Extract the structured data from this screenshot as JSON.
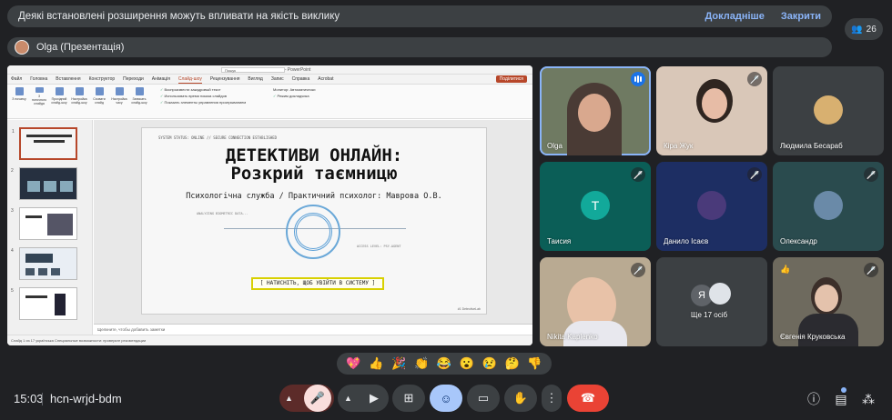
{
  "banner": {
    "message": "Деякі встановлені розширення можуть впливати на якість виклику",
    "details_link": "Докладніше",
    "close_link": "Закрити"
  },
  "participants_count": "26",
  "presenter": {
    "label": "Olga (Презентація)"
  },
  "presentation": {
    "window_title": "CYBER_DETECTIVE_03 — PowerPoint",
    "search_placeholder": "Пошук",
    "menu": [
      "Файл",
      "Головна",
      "Вставлення",
      "Конструктор",
      "Переходи",
      "Анімація",
      "Слайд-шоу",
      "Рецензування",
      "Вигляд",
      "Запис",
      "Справка",
      "Acrobat"
    ],
    "active_menu": "Слайд-шоу",
    "share_label": "Поділитися",
    "ribbon_buttons": [
      "З початку",
      "З поточного слайда",
      "Прохідний слайд-шоу",
      "Настройка слайд-шоу",
      "Сховати слайд",
      "Настройка часу",
      "Записать слайд-шоу"
    ],
    "ribbon_options": [
      "Воспроизвести закадровый текст",
      "Использовать время показа слайдов",
      "Показать элементы управления проигрыванием"
    ],
    "monitor_label": "Монитор: Автоматически",
    "presenter_view": "Режим докладчика",
    "slide": {
      "system_line": "SYSTEM STATUS: ONLINE // SECURE CONNECTION ESTABLISHED",
      "title_line1": "ДЕТЕКТИВИ ОНЛАЙН:",
      "title_line2": "Розкрий таємницю",
      "subtitle": "Психологічна служба / Практичний психолог: Маврова О.В.",
      "left_text": "ANALYZING BIOMETRIC DATA...",
      "right_text": "ACCESS LEVEL: PSY-AGENT",
      "enter_button": "[ НАТИСНІТЬ, ЩОБ УВІЙТИ В СИСТЕМУ ]",
      "footer": "#1 DetectiveLab"
    },
    "notes_placeholder": "Щелкните, чтобы добавить заметки",
    "status_text": "Слайд 1 из 17  українська  Специальные возможности: проверьте рекомендации"
  },
  "participants": [
    {
      "name": "Olga",
      "state": "speaking"
    },
    {
      "name": "Кіра Жук",
      "state": "muted"
    },
    {
      "name": "Людмила Бесараб",
      "state": "none"
    },
    {
      "name": "Таисия",
      "initial": "Т",
      "state": "muted"
    },
    {
      "name": "Данило Ісаєв",
      "state": "muted"
    },
    {
      "name": "Олександр",
      "state": "muted"
    },
    {
      "name": "Nikita Kaplenko",
      "state": "muted"
    },
    {
      "name": "Ще 17 осіб",
      "initial": "Я",
      "state": "none"
    },
    {
      "name": "Євгенія Круковська",
      "state": "muted"
    }
  ],
  "reactions": [
    "💖",
    "👍",
    "🎉",
    "👏",
    "😂",
    "😮",
    "😢",
    "🤔",
    "👎"
  ],
  "footer": {
    "time": "15:03",
    "meeting_code": "hcn-wrjd-bdm"
  },
  "colors": {
    "background": "#202124",
    "tile": "#3c4043",
    "accent": "#8ab4f8",
    "end_call": "#ea4335",
    "mic_off": "#f9dedc",
    "emoji_active": "#a8c7fa"
  }
}
